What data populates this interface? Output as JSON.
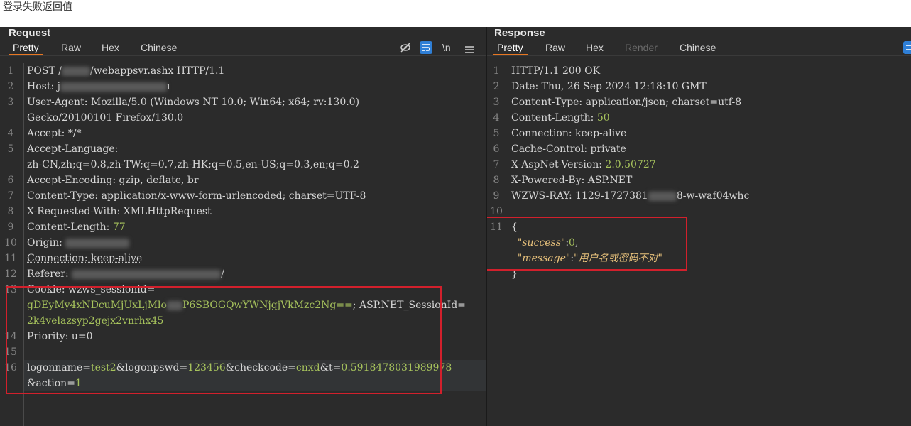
{
  "caption": "登录失败返回值",
  "request": {
    "title": "Request",
    "tabs": [
      "Pretty",
      "Raw",
      "Hex",
      "Chinese"
    ],
    "active_tab": "Pretty",
    "lines": [
      {
        "n": "1",
        "parts": [
          "POST /",
          "",
          "/webappsvr.ashx HTTP/1.1"
        ]
      },
      {
        "n": "2",
        "parts": [
          "Host: j",
          "",
          ""
        ]
      },
      {
        "n": "3",
        "parts": [
          "User-Agent: Mozilla/5.0 (Windows NT 10.0; Win64; x64; rv:130.0)"
        ]
      },
      {
        "n": "",
        "parts": [
          "Gecko/20100101 Firefox/130.0"
        ]
      },
      {
        "n": "4",
        "parts": [
          "Accept: */*"
        ]
      },
      {
        "n": "5",
        "parts": [
          "Accept-Language:"
        ]
      },
      {
        "n": "",
        "parts": [
          "zh-CN,zh;q=0.8,zh-TW;q=0.7,zh-HK;q=0.5,en-US;q=0.3,en;q=0.2"
        ]
      },
      {
        "n": "6",
        "parts": [
          "Accept-Encoding: gzip, deflate, br"
        ]
      },
      {
        "n": "7",
        "parts": [
          "Content-Type: application/x-www-form-urlencoded; charset=UTF-8"
        ]
      },
      {
        "n": "8",
        "parts": [
          "X-Requested-With: XMLHttpRequest"
        ]
      },
      {
        "n": "9",
        "key": "Content-Length: ",
        "val": "77"
      },
      {
        "n": "10",
        "parts": [
          "Origin: ",
          "",
          ""
        ]
      },
      {
        "n": "11",
        "parts": [
          "Connection: keep-alive"
        ]
      },
      {
        "n": "12",
        "parts": [
          "Referer: ",
          "",
          "/"
        ]
      },
      {
        "n": "13",
        "parts": [
          "Cookie: wzws_sessionid="
        ]
      },
      {
        "n": "",
        "cookie1": "gDEyMy4xNDcuMjUxLjMlo",
        "cookie2": "P6SBOGQwYWNjgjVkMzc2Ng==",
        "cookie3": "; ASP.NET_SessionId="
      },
      {
        "n": "",
        "val": "2k4velazsyp2gejx2vnrhx45"
      },
      {
        "n": "14",
        "parts": [
          "Priority: u=0"
        ]
      },
      {
        "n": "15",
        "parts": [
          ""
        ]
      },
      {
        "n": "16",
        "body": [
          "logonname=",
          "test2",
          "&logonpswd=",
          "123456",
          "&checkcode=",
          "cnxd",
          "&t=",
          "0.5918478031989978"
        ]
      },
      {
        "n": "",
        "body2": [
          "&action=",
          "1"
        ]
      }
    ]
  },
  "response": {
    "title": "Response",
    "tabs": [
      "Pretty",
      "Raw",
      "Hex",
      "Render",
      "Chinese"
    ],
    "active_tab": "Pretty",
    "disabled_tab": "Render",
    "lines": [
      {
        "n": "1",
        "text": "HTTP/1.1 200 OK"
      },
      {
        "n": "2",
        "text": "Date: Thu, 26 Sep 2024 12:18:10 GMT"
      },
      {
        "n": "3",
        "text": "Content-Type: application/json; charset=utf-8"
      },
      {
        "n": "4",
        "key": "Content-Length: ",
        "val": "50"
      },
      {
        "n": "5",
        "text": "Connection: keep-alive"
      },
      {
        "n": "6",
        "text": "Cache-Control: private"
      },
      {
        "n": "7",
        "key": "X-AspNet-Version: ",
        "val": "2.0.50727"
      },
      {
        "n": "8",
        "text": "X-Powered-By: ASP.NET"
      },
      {
        "n": "9",
        "text_a": "WZWS-RAY: 1129-1727381",
        "text_b": "8-w-waf04whc"
      },
      {
        "n": "10",
        "text": ""
      },
      {
        "n": "11",
        "text": "{"
      },
      {
        "n": "",
        "json_key": "\"success\"",
        "json_val": "0"
      },
      {
        "n": "",
        "json_key": "\"message\"",
        "json_val": "\"用户名或密码不对\""
      },
      {
        "n": "",
        "text": "}"
      }
    ]
  }
}
